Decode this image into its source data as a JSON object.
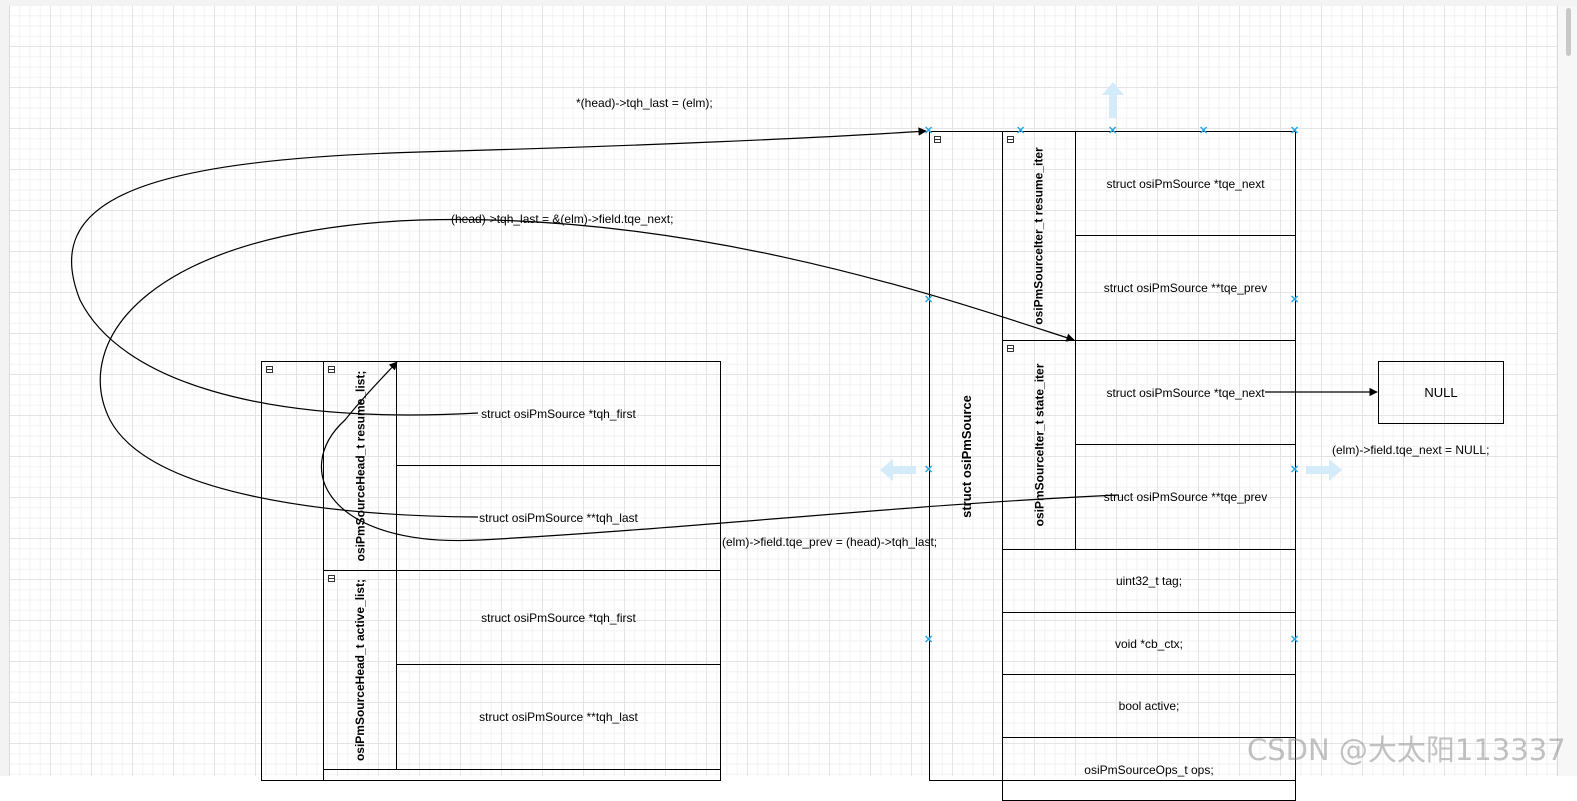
{
  "colors": {
    "connector_marker": "#29a8e6",
    "guide_arrow": "#d4ecfa",
    "line": "#000000"
  },
  "left_struct": {
    "resume_list_label": "osiPmSourceHead_t resume_list;",
    "active_list_label": "osiPmSourceHead_t active_list;",
    "fields": [
      "struct osiPmSource *tqh_first",
      "struct osiPmSource **tqh_last",
      "struct osiPmSource *tqh_first",
      "struct osiPmSource **tqh_last"
    ]
  },
  "right_struct": {
    "outer_label": "struct osiPmSource",
    "resume_iter_label": "osiPmSourceIter_t resume_iter",
    "state_iter_label": "osiPmSourceIter_t state_iter",
    "iter_fields": [
      "struct osiPmSource *tqe_next",
      "struct osiPmSource **tqe_prev",
      "struct osiPmSource *tqe_next",
      "struct osiPmSource **tqe_prev"
    ],
    "plain_fields": [
      "uint32_t tag;",
      "void *cb_ctx;",
      "bool active;",
      "osiPmSourceOps_t ops;"
    ]
  },
  "null_box": "NULL",
  "edge_labels": {
    "tqh_last_elm": "*(head)->tqh_last = (elm);",
    "tqh_last_tqe_next": "(head)->tqh_last = &(elm)->field.tqe_next;",
    "tqe_prev_head": "(elm)->field.tqe_prev = (head)->tqh_last;",
    "tqe_next_null": "(elm)->field.tqe_next = NULL;"
  },
  "watermark": "CSDN @大太阳113337"
}
